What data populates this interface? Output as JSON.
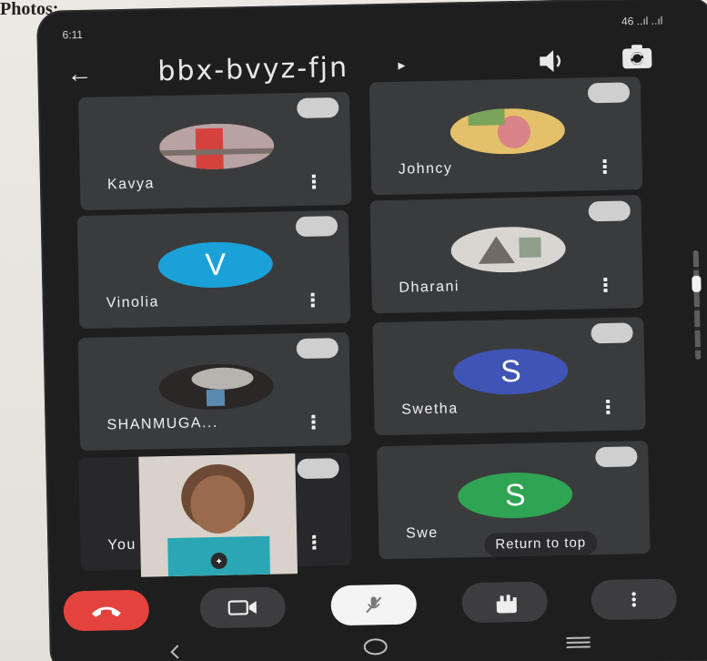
{
  "caption": "Photos:",
  "status": {
    "time": "6:11",
    "right_text": "46 ..ıl ..ıl"
  },
  "header": {
    "meeting_code": "bbx-bvyz-fjn",
    "caret": "▸"
  },
  "participants": [
    {
      "name": "Kavya",
      "avatar": "photo",
      "colors": [
        "#b8a2a2",
        "#d5423d",
        "#7a6e68"
      ]
    },
    {
      "name": "Johncy",
      "avatar": "photo",
      "colors": [
        "#e4c06a",
        "#d98287",
        "#7ba45b"
      ]
    },
    {
      "name": "Vinolia",
      "avatar": "letter",
      "letter": "V",
      "color": "#1aa1d7"
    },
    {
      "name": "Dharani",
      "avatar": "photo",
      "colors": [
        "#d9d6d2",
        "#6f6a66",
        "#8ea08a"
      ]
    },
    {
      "name": "SHANMUGA...",
      "avatar": "photo",
      "colors": [
        "#2a2726",
        "#b7b3af",
        "#5a8ab2"
      ]
    },
    {
      "name": "Swetha",
      "avatar": "letter",
      "letter": "S",
      "color": "#4054b6"
    },
    {
      "name": "You",
      "avatar": "self"
    },
    {
      "name": "Swe",
      "avatar": "letter",
      "letter": "S",
      "color": "#2fa453"
    }
  ],
  "return_to_top": "Return to top",
  "colors": {
    "end_call": "#e4423d",
    "control_bg": "#3d3d3f",
    "mic_bg": "#f4f4f4",
    "tile_bg": "#3a3b3d"
  },
  "controls": [
    "end-call",
    "camera",
    "mute-mic",
    "raise-hand",
    "more-options"
  ],
  "nav": [
    "back",
    "home",
    "recents"
  ]
}
